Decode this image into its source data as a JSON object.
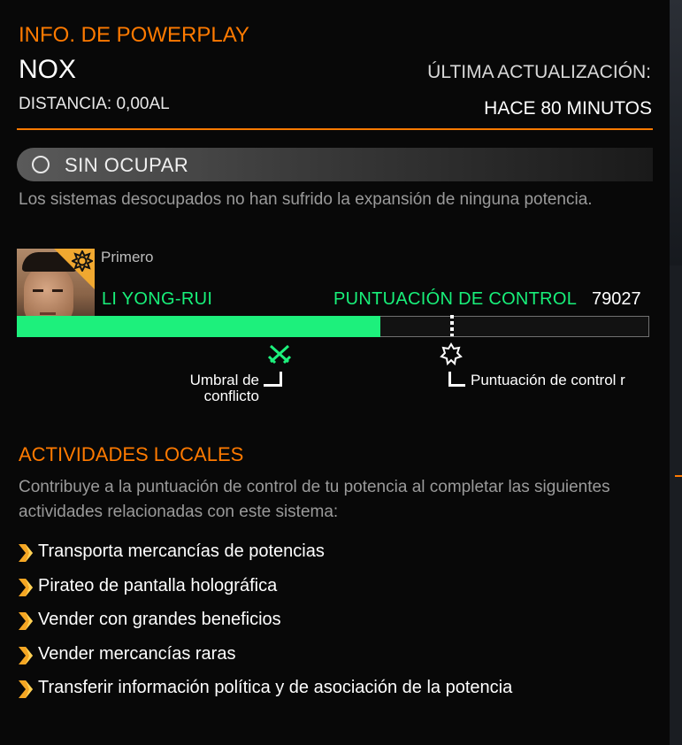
{
  "header": {
    "title": "INFO. DE POWERPLAY",
    "system_name": "NOX",
    "distance": "DISTANCIA: 0,00AL",
    "last_update_label": "ÚLTIMA ACTUALIZACIÓN:",
    "last_update_value": "HACE 80 MINUTOS"
  },
  "status": {
    "label": "SIN OCUPAR",
    "description": "Los sistemas desocupados no han sufrido la expansión de ninguna potencia."
  },
  "leader": {
    "rank": "Primero",
    "name": "LI YONG-RUI",
    "score_label": "PUNTUACIÓN DE CONTROL",
    "score_value": "79027",
    "progress_fraction": 0.575,
    "control_marker_fraction": 0.685
  },
  "thresholds": {
    "conflict": "Umbral de conflicto",
    "control": "Puntuación de control r"
  },
  "activities": {
    "title": "ACTIVIDADES LOCALES",
    "description": "Contribuye a la puntuación de control de tu potencia al completar las siguientes actividades relacionadas con este sistema:",
    "items": [
      "Transporta mercancías de potencias",
      "Pirateo de pantalla holográfica",
      "Vender con grandes beneficios",
      "Vender mercancías raras",
      "Transferir información política y de asociación de la potencia"
    ]
  },
  "colors": {
    "accent": "#ff7a00",
    "progress": "#1df07c",
    "label_green": "#18f07a",
    "power_badge": "#f0a830"
  },
  "icons": {
    "status": "empty-circle-icon",
    "power": "sun-emblem-icon",
    "conflict": "crossed-swords-icon",
    "control": "control-star-icon",
    "bullet": "chevron-right-icon"
  }
}
